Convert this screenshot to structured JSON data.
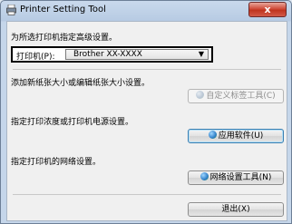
{
  "window": {
    "title": "Printer Setting Tool",
    "close_label": "x"
  },
  "intro": {
    "text": "为所选打印机指定高级设置。"
  },
  "printer": {
    "label": "打印机(P):",
    "selected": "Brother XX-XXXX"
  },
  "sections": [
    {
      "description": "添加新纸张大小或编辑纸张大小设置。",
      "button_label": "自定义标签工具(C)",
      "enabled": false
    },
    {
      "description": "指定打印浓度或打印机电源设置。",
      "button_label": "应用软件(U)",
      "enabled": true
    },
    {
      "description": "指定打印机的网络设置。",
      "button_label": "网络设置工具(N)",
      "enabled": true
    }
  ],
  "exit": {
    "label": "退出(X)"
  }
}
